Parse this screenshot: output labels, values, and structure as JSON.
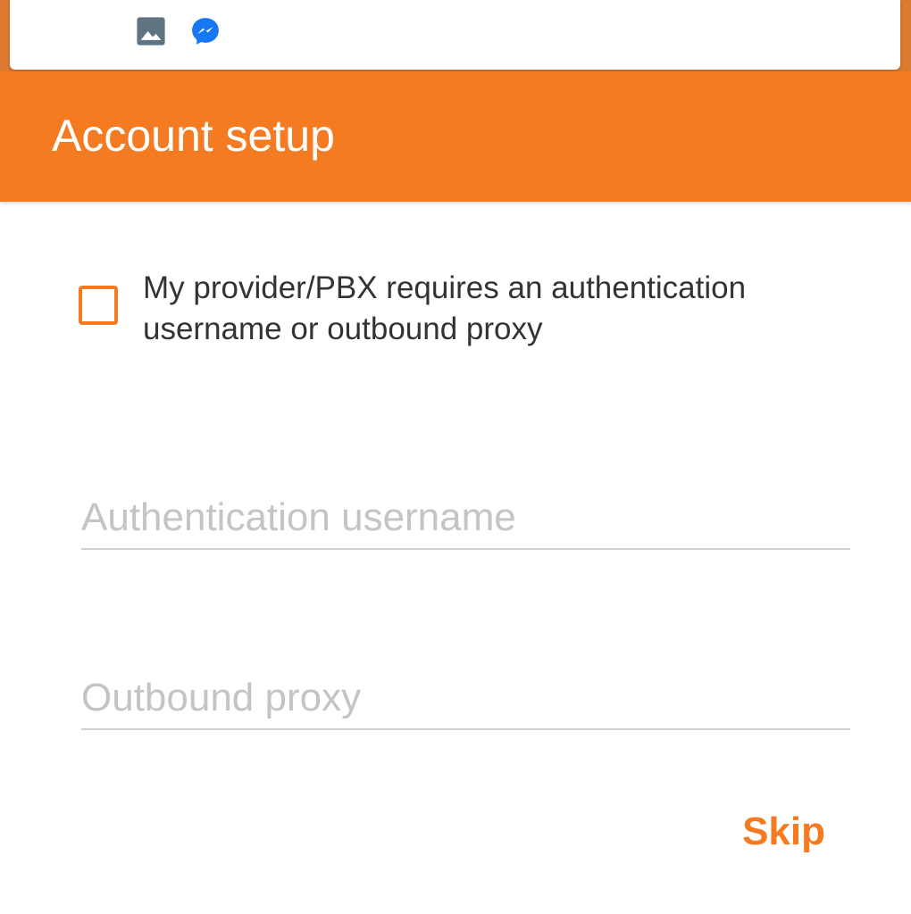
{
  "notification": {
    "icons": [
      "image-icon",
      "messenger-icon"
    ],
    "colors": {
      "image_icon": "#5f7481",
      "messenger_icon": "#1877f2"
    }
  },
  "app_bar": {
    "title": "Account setup",
    "color": "#f47b22"
  },
  "form": {
    "checkbox": {
      "label": "My provider/PBX requires an authentication username or outbound proxy",
      "checked": false
    },
    "auth_username": {
      "value": "",
      "placeholder": "Authentication username"
    },
    "outbound_proxy": {
      "value": "",
      "placeholder": "Outbound proxy"
    }
  },
  "actions": {
    "skip_label": "Skip"
  }
}
